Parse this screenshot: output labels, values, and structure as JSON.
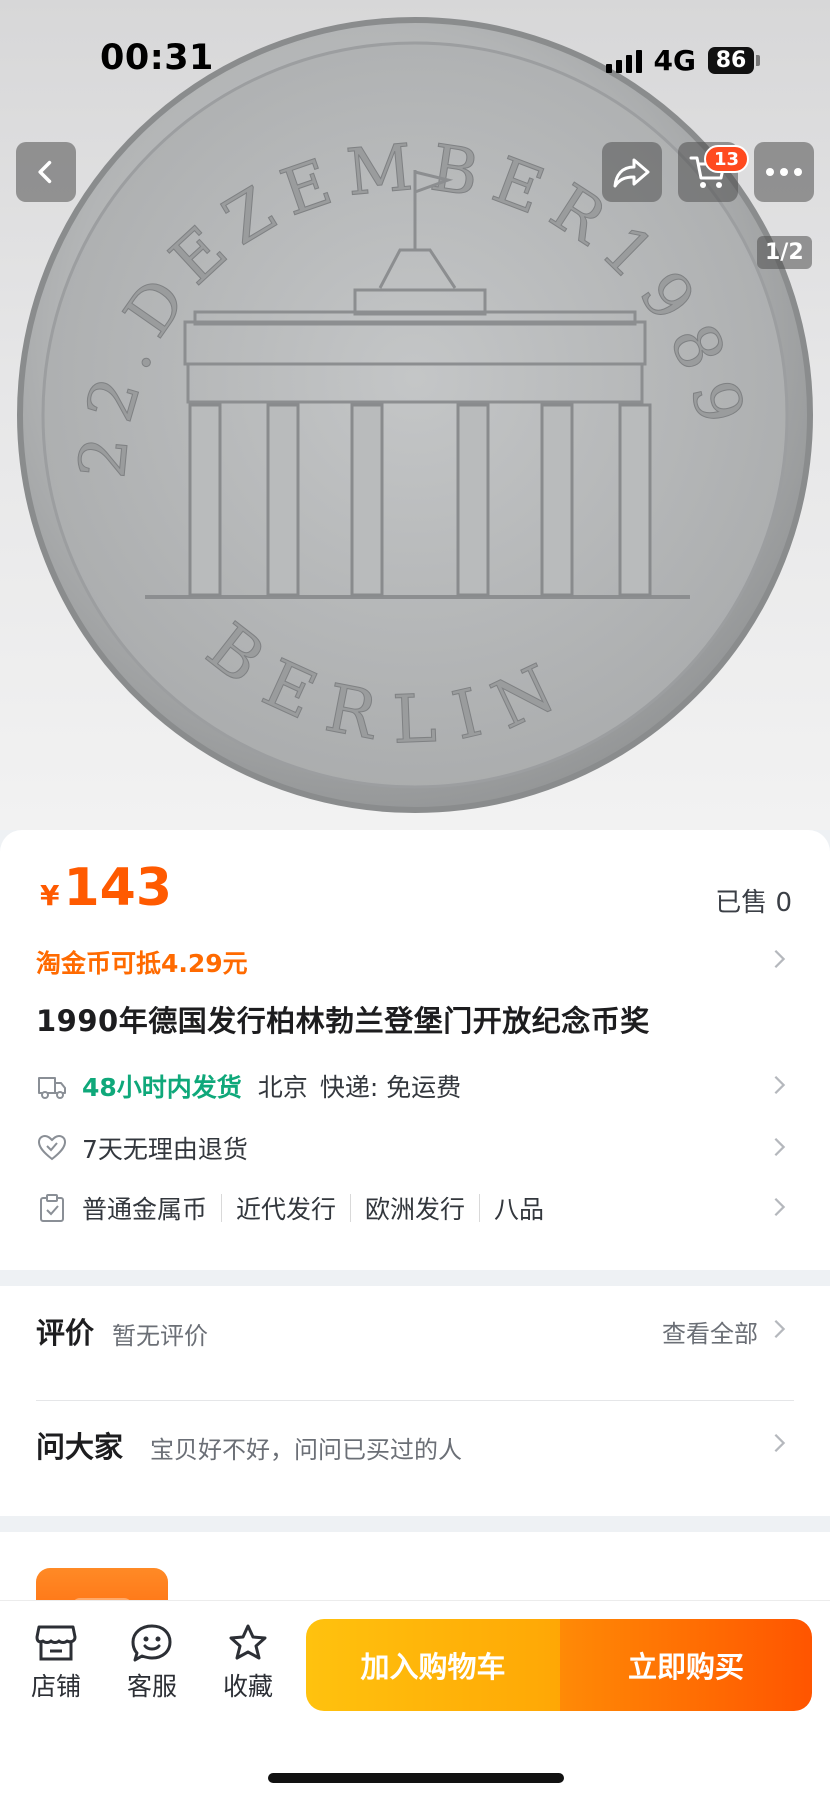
{
  "status_bar": {
    "time": "00:31",
    "network": "4G",
    "battery": "86"
  },
  "gallery": {
    "counter": "1/2",
    "coin_top_text": "22.DEZEMBER1989",
    "coin_bottom_text": "BERLIN"
  },
  "header": {
    "cart_count": "13"
  },
  "icons": {
    "back": "chevron-left-icon",
    "share": "share-icon",
    "cart": "cart-icon",
    "more": "more-icon",
    "shipping": "truck-icon",
    "returns": "heart-shield-icon",
    "params": "clipboard-icon",
    "shop": "store-icon",
    "service": "chat-face-icon",
    "favorite": "star-icon"
  },
  "product": {
    "currency": "¥",
    "price": "143",
    "sold": "已售 0",
    "coin_offer": "淘金币可抵4.29元",
    "title": "1990年德国发行柏林勃兰登堡门开放纪念币奖"
  },
  "shipping": {
    "speed": "48小时内发货",
    "origin": "北京",
    "method": "快递: 免运费"
  },
  "service": {
    "returns": "7天无理由退货"
  },
  "attributes": [
    "普通金属币",
    "近代发行",
    "欧洲发行",
    "八品"
  ],
  "reviews": {
    "title": "评价",
    "summary": "暂无评价",
    "view_all": "查看全部"
  },
  "ask": {
    "title": "问大家",
    "prompt": "宝贝好不好，问问已买过的人"
  },
  "bottom_bar": {
    "shop": "店铺",
    "service": "客服",
    "favorite": "收藏",
    "add_to_cart": "加入购物车",
    "buy_now": "立即购买"
  },
  "colors": {
    "accent": "#ff5a00",
    "green": "#0fa87a",
    "cart_btn": "#ffb30a",
    "buy_btn": "#ff6a00",
    "badge": "#ff4a1f"
  }
}
